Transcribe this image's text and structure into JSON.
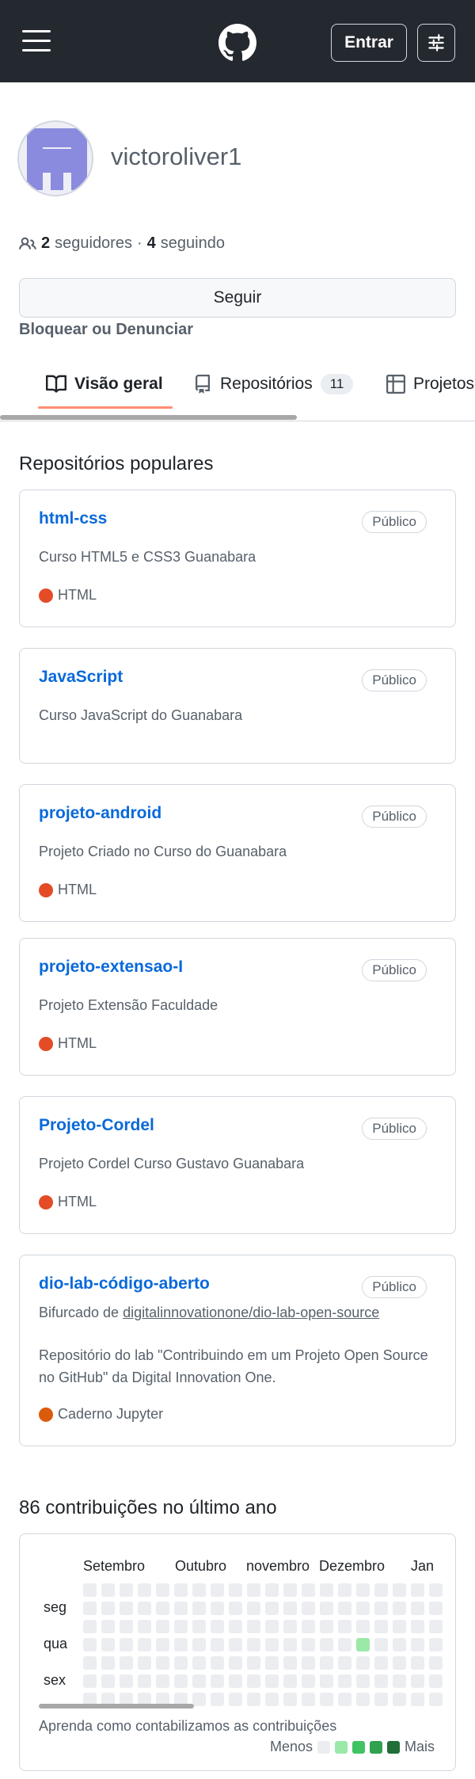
{
  "header": {
    "signin_label": "Entrar",
    "menu_icon": "hamburger-icon",
    "logo_icon": "github-logo-icon",
    "settings_icon": "sliders-icon"
  },
  "profile": {
    "username": "victoroliver1",
    "followers_count": "2",
    "followers_label": "seguidores",
    "separator": "·",
    "following_count": "4",
    "following_label": "seguindo",
    "follow_button": "Seguir",
    "block_link": "Bloquear ou Denunciar"
  },
  "tabs": {
    "overview": "Visão geral",
    "repositories": "Repositórios",
    "repositories_count": "11",
    "projects": "Projetos"
  },
  "popular": {
    "title": "Repositórios populares",
    "repos": [
      {
        "name": "html-css",
        "visibility": "Público",
        "description": "Curso HTML5 e CSS3 Guanabara",
        "language": "HTML",
        "lang_color": "#e34c26"
      },
      {
        "name": "JavaScript",
        "visibility": "Público",
        "description": "Curso JavaScript do Guanabara"
      },
      {
        "name": "projeto-android",
        "visibility": "Público",
        "description": "Projeto Criado no Curso do Guanabara",
        "language": "HTML",
        "lang_color": "#e34c26"
      },
      {
        "name": "projeto-extensao-I",
        "visibility": "Público",
        "description": "Projeto Extensão Faculdade",
        "language": "HTML",
        "lang_color": "#e34c26"
      },
      {
        "name": "Projeto-Cordel",
        "visibility": "Público",
        "description": "Projeto Cordel Curso Gustavo Guanabara",
        "language": "HTML",
        "lang_color": "#e34c26"
      },
      {
        "name": "dio-lab-código-aberto",
        "visibility": "Público",
        "fork_prefix": "Bifurcado de",
        "fork_source": "digitalinnovationone/dio-lab-open-source",
        "description_line1": "Repositório do lab \"Contribuindo em um Projeto Open Source",
        "description_line2": "no GitHub\" da Digital Innovation One.",
        "language": "Caderno Jupyter",
        "lang_color": "#DA5B0B"
      }
    ]
  },
  "contributions": {
    "title": "86 contribuições no último ano",
    "months": [
      "Setembro",
      "Outubro",
      "novembro",
      "Dezembro",
      "Jan"
    ],
    "days": [
      "seg",
      "qua",
      "sex"
    ],
    "help_link": "Aprenda como contabilizamos as contribuições",
    "legend_less": "Menos",
    "legend_more": "Mais",
    "legend_colors": [
      "#ebedf0",
      "#9be9a8",
      "#40c463",
      "#30a14e",
      "#216e39"
    ],
    "highlight_color": "#9be9a8"
  }
}
